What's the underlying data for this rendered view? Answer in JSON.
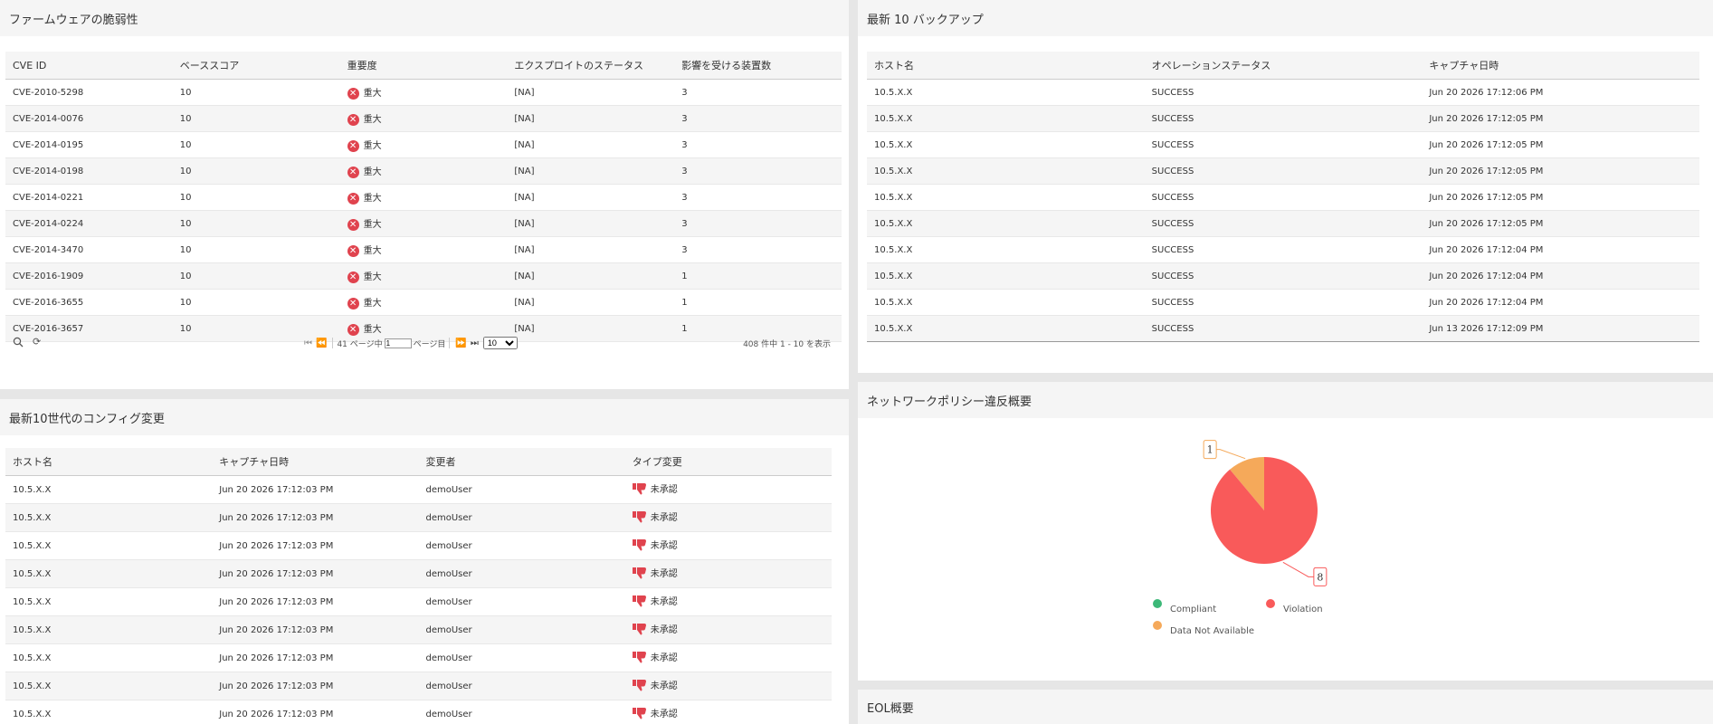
{
  "firmware": {
    "title": "ファームウェアの脆弱性",
    "columns": [
      "CVE ID",
      "ベーススコア",
      "重要度",
      "エクスプロイトのステータス",
      "影響を受ける装置数"
    ],
    "rows": [
      {
        "cve": "CVE-2010-5298",
        "score": "10",
        "severity": "重大",
        "status": "[NA]",
        "devices": "3"
      },
      {
        "cve": "CVE-2014-0076",
        "score": "10",
        "severity": "重大",
        "status": "[NA]",
        "devices": "3"
      },
      {
        "cve": "CVE-2014-0195",
        "score": "10",
        "severity": "重大",
        "status": "[NA]",
        "devices": "3"
      },
      {
        "cve": "CVE-2014-0198",
        "score": "10",
        "severity": "重大",
        "status": "[NA]",
        "devices": "3"
      },
      {
        "cve": "CVE-2014-0221",
        "score": "10",
        "severity": "重大",
        "status": "[NA]",
        "devices": "3"
      },
      {
        "cve": "CVE-2014-0224",
        "score": "10",
        "severity": "重大",
        "status": "[NA]",
        "devices": "3"
      },
      {
        "cve": "CVE-2014-3470",
        "score": "10",
        "severity": "重大",
        "status": "[NA]",
        "devices": "3"
      },
      {
        "cve": "CVE-2016-1909",
        "score": "10",
        "severity": "重大",
        "status": "[NA]",
        "devices": "1"
      },
      {
        "cve": "CVE-2016-3655",
        "score": "10",
        "severity": "重大",
        "status": "[NA]",
        "devices": "1"
      },
      {
        "cve": "CVE-2016-3657",
        "score": "10",
        "severity": "重大",
        "status": "[NA]",
        "devices": "1"
      }
    ],
    "pager": {
      "pages_text": "41 ページ中",
      "page_value": "1",
      "page_suffix": "ページ目",
      "page_size": "10",
      "summary": "408 件中 1 - 10 を表示"
    }
  },
  "backups": {
    "title": "最新 10 バックアップ",
    "columns": [
      "ホスト名",
      "オペレーションステータス",
      "キャプチャ日時"
    ],
    "rows": [
      {
        "host": "10.5.X.X",
        "status": "SUCCESS",
        "time": "Jun 20 2026 17:12:06 PM"
      },
      {
        "host": "10.5.X.X",
        "status": "SUCCESS",
        "time": "Jun 20 2026 17:12:05 PM"
      },
      {
        "host": "10.5.X.X",
        "status": "SUCCESS",
        "time": "Jun 20 2026 17:12:05 PM"
      },
      {
        "host": "10.5.X.X",
        "status": "SUCCESS",
        "time": "Jun 20 2026 17:12:05 PM"
      },
      {
        "host": "10.5.X.X",
        "status": "SUCCESS",
        "time": "Jun 20 2026 17:12:05 PM"
      },
      {
        "host": "10.5.X.X",
        "status": "SUCCESS",
        "time": "Jun 20 2026 17:12:05 PM"
      },
      {
        "host": "10.5.X.X",
        "status": "SUCCESS",
        "time": "Jun 20 2026 17:12:04 PM"
      },
      {
        "host": "10.5.X.X",
        "status": "SUCCESS",
        "time": "Jun 20 2026 17:12:04 PM"
      },
      {
        "host": "10.5.X.X",
        "status": "SUCCESS",
        "time": "Jun 20 2026 17:12:04 PM"
      },
      {
        "host": "10.5.X.X",
        "status": "SUCCESS",
        "time": "Jun 13 2026 17:12:09 PM"
      }
    ]
  },
  "config": {
    "title": "最新10世代のコンフィグ変更",
    "columns": [
      "ホスト名",
      "キャプチャ日時",
      "変更者",
      "タイプ変更"
    ],
    "rows": [
      {
        "host": "10.5.X.X",
        "time": "Jun 20 2026 17:12:03 PM",
        "user": "demoUser",
        "type": "未承認"
      },
      {
        "host": "10.5.X.X",
        "time": "Jun 20 2026 17:12:03 PM",
        "user": "demoUser",
        "type": "未承認"
      },
      {
        "host": "10.5.X.X",
        "time": "Jun 20 2026 17:12:03 PM",
        "user": "demoUser",
        "type": "未承認"
      },
      {
        "host": "10.5.X.X",
        "time": "Jun 20 2026 17:12:03 PM",
        "user": "demoUser",
        "type": "未承認"
      },
      {
        "host": "10.5.X.X",
        "time": "Jun 20 2026 17:12:03 PM",
        "user": "demoUser",
        "type": "未承認"
      },
      {
        "host": "10.5.X.X",
        "time": "Jun 20 2026 17:12:03 PM",
        "user": "demoUser",
        "type": "未承認"
      },
      {
        "host": "10.5.X.X",
        "time": "Jun 20 2026 17:12:03 PM",
        "user": "demoUser",
        "type": "未承認"
      },
      {
        "host": "10.5.X.X",
        "time": "Jun 20 2026 17:12:03 PM",
        "user": "demoUser",
        "type": "未承認"
      },
      {
        "host": "10.5.X.X",
        "time": "Jun 20 2026 17:12:03 PM",
        "user": "demoUser",
        "type": "未承認"
      }
    ]
  },
  "policy": {
    "title": "ネットワークポリシー違反概要",
    "legend": {
      "compliant": "Compliant",
      "violation": "Violation",
      "na": "Data Not Available"
    },
    "colors": {
      "compliant": "#3cb878",
      "violation": "#f95a5a",
      "na": "#f5a95a"
    }
  },
  "chart_data": {
    "type": "pie",
    "labels": [
      "Compliant",
      "Violation",
      "Data Not Available"
    ],
    "values": [
      0,
      8,
      1
    ]
  },
  "eol": {
    "title": "EOL概要"
  }
}
